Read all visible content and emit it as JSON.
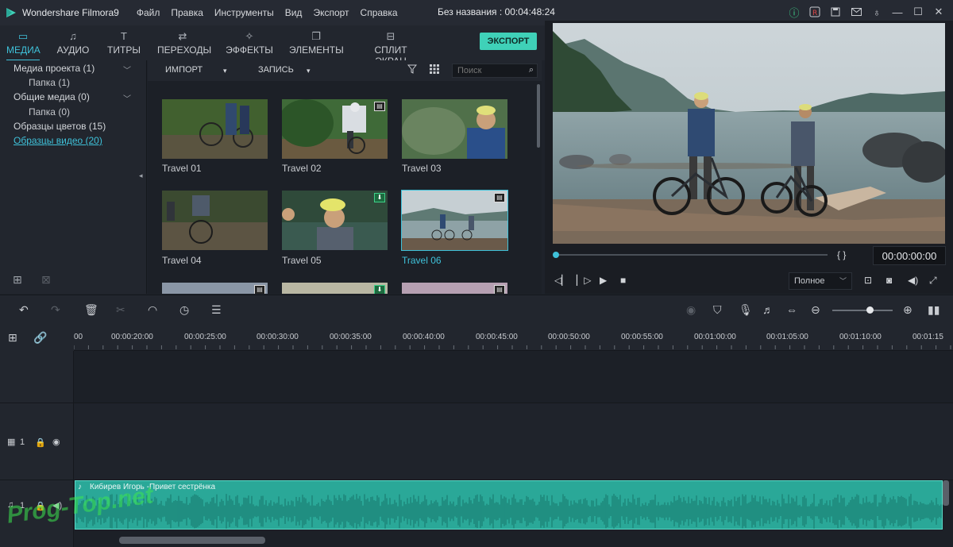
{
  "titlebar": {
    "app_name": "Wondershare Filmora9",
    "menu": [
      "Файл",
      "Правка",
      "Инструменты",
      "Вид",
      "Экспорт",
      "Справка"
    ],
    "document_title": "Без названия : 00:04:48:24"
  },
  "tabs": [
    {
      "label": "МЕДИА",
      "icon": "folder-icon",
      "active": true
    },
    {
      "label": "АУДИО",
      "icon": "music-note-icon"
    },
    {
      "label": "ТИТРЫ",
      "icon": "text-icon"
    },
    {
      "label": "ПЕРЕХОДЫ",
      "icon": "transition-icon"
    },
    {
      "label": "ЭФФЕКТЫ",
      "icon": "effects-icon"
    },
    {
      "label": "ЭЛЕМЕНТЫ",
      "icon": "elements-icon"
    },
    {
      "label": "СПЛИТ ЭКРАН",
      "icon": "split-screen-icon"
    }
  ],
  "export_label": "ЭКСПОРТ",
  "tree": {
    "items": [
      {
        "label": "Медиа проекта (1)"
      },
      {
        "label": "Папка (1)"
      },
      {
        "label": "Общие медиа (0)"
      },
      {
        "label": "Папка (0)"
      },
      {
        "label": "Образцы цветов (15)"
      },
      {
        "label": "Образцы видео (20)",
        "selected": true
      }
    ]
  },
  "media_toolbar": {
    "import_label": "ИМПОРТ",
    "record_label": "ЗАПИСЬ",
    "search_placeholder": "Поиск"
  },
  "media_items": [
    {
      "label": "Travel 01"
    },
    {
      "label": "Travel 02"
    },
    {
      "label": "Travel 03"
    },
    {
      "label": "Travel 04"
    },
    {
      "label": "Travel 05"
    },
    {
      "label": "Travel 06",
      "selected": true
    }
  ],
  "preview": {
    "timecode": "00:00:00:00",
    "quality": "Полное",
    "brackets": "{   }"
  },
  "ruler": {
    "ticks": [
      "00",
      "00:00:20:00",
      "00:00:25:00",
      "00:00:30:00",
      "00:00:35:00",
      "00:00:40:00",
      "00:00:45:00",
      "00:00:50:00",
      "00:00:55:00",
      "00:01:00:00",
      "00:01:05:00",
      "00:01:10:00",
      "00:01:15"
    ]
  },
  "tracks": {
    "video_label": "1",
    "audio_label": "1",
    "audio_clip_title": "Кибирев Игорь -Привет сестрёнка"
  },
  "watermark": "Prog-Top.net"
}
